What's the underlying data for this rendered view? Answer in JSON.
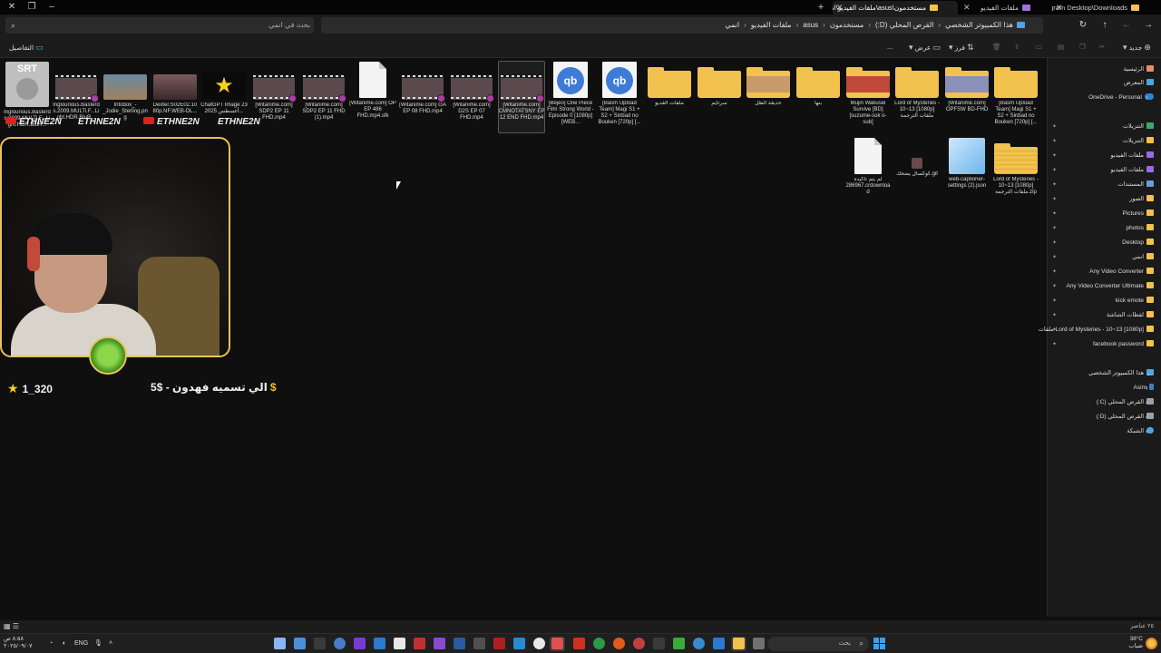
{
  "window": {
    "tabs": [
      {
        "label": "مستخدمون\\asus\\ملفات الفيديو\\انمي",
        "active": true
      },
      {
        "label": "ملفات الفيديو",
        "active": false
      },
      {
        "label": "Telegram Desktop\\Downloads\\",
        "active": false
      }
    ],
    "new_tab": "+"
  },
  "address": {
    "search_placeholder": "بحث في انمي",
    "breadcrumb": [
      "هذا الكمبيوتر الشخصي",
      "القرص المحلي (D:)",
      "مستخدمون",
      "asus",
      "ملفات الفيديو",
      "انمي"
    ]
  },
  "commands": {
    "new": "جديد",
    "sort": "فرز",
    "view": "عرض",
    "more": "...",
    "details": "التفاصيل"
  },
  "sidebar": {
    "top": [
      {
        "label": "الرئيسية",
        "icon": "home-icon"
      },
      {
        "label": "المعرض",
        "icon": "gallery-icon"
      },
      {
        "label": "OneDrive - Personal",
        "icon": "cloud-icon"
      }
    ],
    "pinned": [
      {
        "label": "التنزيلات",
        "icon": "download-icon"
      },
      {
        "label": "التنزيلات",
        "icon": "folder-icon"
      },
      {
        "label": "ملفات الفيديو",
        "icon": "video-folder-icon"
      },
      {
        "label": "ملفات الفيديو",
        "icon": "video-folder-icon"
      },
      {
        "label": "المستندات",
        "icon": "documents-icon"
      },
      {
        "label": "الصور",
        "icon": "folder-icon"
      },
      {
        "label": "Pictures",
        "icon": "folder-icon"
      },
      {
        "label": "photos",
        "icon": "folder-icon"
      },
      {
        "label": "Desktop",
        "icon": "folder-icon"
      },
      {
        "label": "انمي",
        "icon": "folder-icon"
      },
      {
        "label": "Any Video Converter",
        "icon": "folder-icon"
      },
      {
        "label": "Any Video Converter Ultimate",
        "icon": "folder-icon"
      },
      {
        "label": "kick emote",
        "icon": "folder-icon"
      },
      {
        "label": "لقطات الشاشة",
        "icon": "folder-icon"
      },
      {
        "label": "Lord of Mysteries - 10~13 [1080p] ملفات",
        "icon": "folder-icon"
      },
      {
        "label": "facebook password",
        "icon": "folder-icon"
      }
    ],
    "pc": {
      "label": "هذا الكمبيوتر الشخصي",
      "icon": "pc-icon"
    },
    "drives": [
      {
        "label": "Asim",
        "icon": "user-icon"
      },
      {
        "label": "القرص المحلي (C:)",
        "icon": "drive-icon"
      },
      {
        "label": "القرص المحلي (D:)",
        "icon": "drive-icon",
        "selected": true
      }
    ],
    "network": {
      "label": "الشبكة",
      "icon": "network-icon"
    }
  },
  "files": [
    {
      "name": "[Basm Upload Team] Magi S1 + S2 + Sinbad no Bouken [720p] [...",
      "type": "folder"
    },
    {
      "name": "[Witanime.com] OPFSW BD-FHD",
      "type": "folder-pic2"
    },
    {
      "name": "Lord of Mysteries - 10~13 [1080p] ملفات الترجمة",
      "type": "folder-sub"
    },
    {
      "name": "Mujin Wakusei Survive [BD][suzume-sok o-sub]",
      "type": "folder-pic"
    },
    {
      "name": "بنها",
      "type": "folder"
    },
    {
      "name": "حديقة الظل",
      "type": "folder-pic3"
    },
    {
      "name": "سرتايم",
      "type": "folder"
    },
    {
      "name": "ملفات الفديو",
      "type": "folder"
    },
    {
      "name": "[Basm Upload Team] Magi S1 + S2 + Sinbad no Bouken [720p] [...",
      "type": "qbittorrent"
    },
    {
      "name": "[Bejeo] One Piece Film Strong World - Episode 0 [1080p] [WEB...",
      "type": "qbittorrent"
    },
    {
      "name": "[Witanime.com] CMNOTATSNY EP 12 END FHD.mp4",
      "type": "video",
      "selected": true
    },
    {
      "name": "[Witanime.com] D2S EP 07 FHD.mp4",
      "type": "video"
    },
    {
      "name": "[Witanime.com] GA EP 08 FHD.mp4",
      "type": "video"
    },
    {
      "name": "[Witanime.com] OP EP 486 FHD.mp4.sfk",
      "type": "document"
    },
    {
      "name": "[Witanime.com] SDP2 EP 11 FHD (1).mp4",
      "type": "video"
    },
    {
      "name": "[Witanime.com] SDP2 EP 11 FHD.mp4",
      "type": "video"
    },
    {
      "name": "ChatGPT Image 23 أغسطس 2025...",
      "type": "star-image"
    },
    {
      "name": "Dexter.S02E02.1080p.NF.WEB-DL...",
      "type": "image"
    },
    {
      "name": "Infobox_-_Jodie_Sterling.png",
      "type": "image"
    },
    {
      "name": "Inglourious.Basterds.2009.MULTi.F...Light.HDR.BluR...",
      "type": "video"
    },
    {
      "name": "Inglourious.Basterds.2009.MULTi.F...Light.HDR.BluR...",
      "type": "subtitle"
    }
  ],
  "files_row2": [
    {
      "name": "Lord of Mysteries - 10~13 [1080p] ملفات الترجمة.zip",
      "type": "zip"
    },
    {
      "name": "web-captioner-settings (2).json",
      "type": "json"
    },
    {
      "name": "كوكسال يضحك.gif",
      "type": "gif"
    },
    {
      "name": "لم يتم تأكيده 286967.crdownload",
      "type": "document"
    }
  ],
  "overlay": {
    "handle_strip": [
      "ETHNE2N",
      "ETHNE2N",
      "ETHNE2N",
      "ETHNE2N"
    ],
    "left_text": "1_320",
    "right_text": "الي تسميه فهدون - $5",
    "dollar": "$",
    "star": "★"
  },
  "status": {
    "count": "٢٥ عناصر"
  },
  "taskbar": {
    "search_placeholder": "بحث",
    "lang": "ENG",
    "weather_temp": "38°C",
    "weather_desc": "ضباب",
    "clock_time": "٨:٥٨ ص",
    "clock_date": "٢٠٢٥/٠٩/٠٧"
  }
}
